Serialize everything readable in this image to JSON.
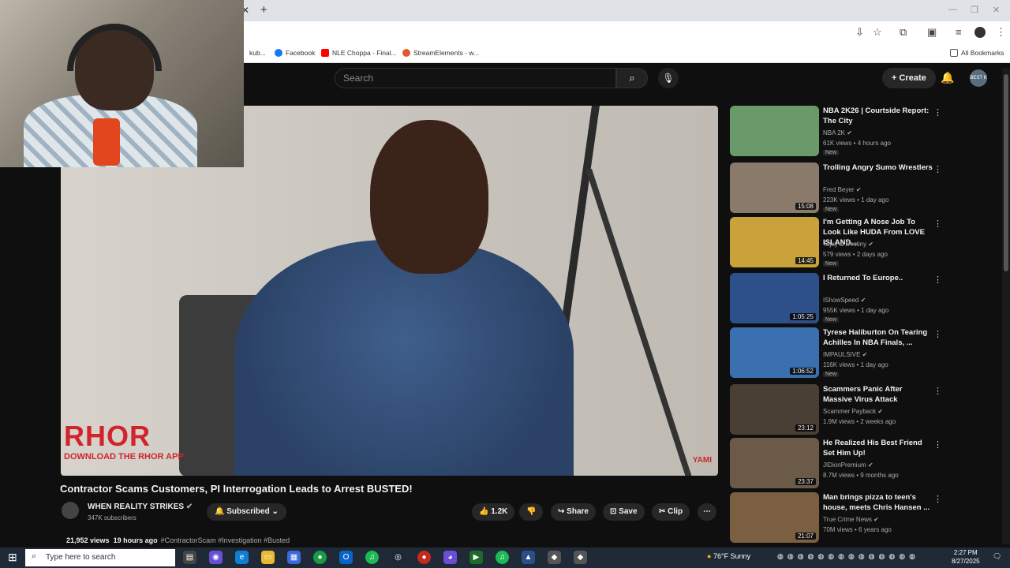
{
  "browser": {
    "toolbar_icons": [
      "install-icon",
      "star-icon",
      "extensions-icon",
      "sidebar-icon",
      "media-icon",
      "profile-icon",
      "menu-icon"
    ],
    "bookmarks": [
      {
        "label": "kub...",
        "color": "#888888"
      },
      {
        "label": "Facebook",
        "color": "#1877f2"
      },
      {
        "label": "NLE Choppa - Final...",
        "color": "#ff0000"
      },
      {
        "label": "StreamElements - w...",
        "color": "#e05a2a"
      }
    ],
    "all_bookmarks": "All Bookmarks"
  },
  "youtube": {
    "search_placeholder": "Search",
    "create_label": "Create",
    "avatar_text": "BEST K"
  },
  "video": {
    "overlay_main": "RHOR",
    "overlay_sub": "DOWNLOAD THE RHOR APP",
    "watermark": "YAMI",
    "title": "Contractor Scams Customers, PI Interrogation Leads to Arrest BUSTED!",
    "channel": "WHEN REALITY STRIKES",
    "subscribers": "347K subscribers",
    "subscribed_label": "Subscribed",
    "likes": "1.2K",
    "share_label": "Share",
    "save_label": "Save",
    "clip_label": "Clip",
    "views": "21,952 views",
    "age": "19 hours ago",
    "tags": "#ContractorScam #Investigation #Busted"
  },
  "recommendations": [
    {
      "title": "NBA 2K26 | Courtside Report: The City",
      "channel": "NBA 2K",
      "views": "61K views • 4 hours ago",
      "badge": "New",
      "duration": "",
      "thumb": "#6a9a6a"
    },
    {
      "title": "Trolling Angry Sumo Wrestlers",
      "channel": "Fred Beyer",
      "views": "223K views • 1 day ago",
      "badge": "New",
      "duration": "15:08",
      "thumb": "#8a7a6a"
    },
    {
      "title": "I'm Getting A Nose Job To Look Like HUDA From LOVE ISLAND...",
      "channel": "Tajay & Destiny",
      "views": "579 views • 2 days ago",
      "badge": "New",
      "duration": "14:45",
      "thumb": "#c9a23a"
    },
    {
      "title": "I Returned To Europe..",
      "channel": "IShowSpeed",
      "views": "955K views • 1 day ago",
      "badge": "New",
      "duration": "1:05:25",
      "thumb": "#2d4f8a"
    },
    {
      "title": "Tyrese Haliburton On Tearing Achilles In NBA Finals, ...",
      "channel": "IMPAULSIVE",
      "views": "116K views • 1 day ago",
      "badge": "New",
      "duration": "1:06:52",
      "thumb": "#3a6fb0"
    },
    {
      "title": "Scammers Panic After Massive Virus Attack",
      "channel": "Scammer Payback",
      "views": "1.9M views • 2 weeks ago",
      "badge": "",
      "duration": "23:12",
      "thumb": "#4a3f35"
    },
    {
      "title": "He Realized His Best Friend Set Him Up!",
      "channel": "JIDionPremium",
      "views": "8.7M views • 9 months ago",
      "badge": "",
      "duration": "23:37",
      "thumb": "#6b5a48"
    },
    {
      "title": "Man brings pizza to teen's house, meets Chris Hansen ...",
      "channel": "True Crime News",
      "views": "70M views • 6 years ago",
      "badge": "",
      "duration": "21:07",
      "thumb": "#7a6040"
    }
  ],
  "taskbar": {
    "search_placeholder": "Type here to search",
    "weather": "76°F  Sunny",
    "time": "2:27 PM",
    "date": "8/27/2025"
  }
}
